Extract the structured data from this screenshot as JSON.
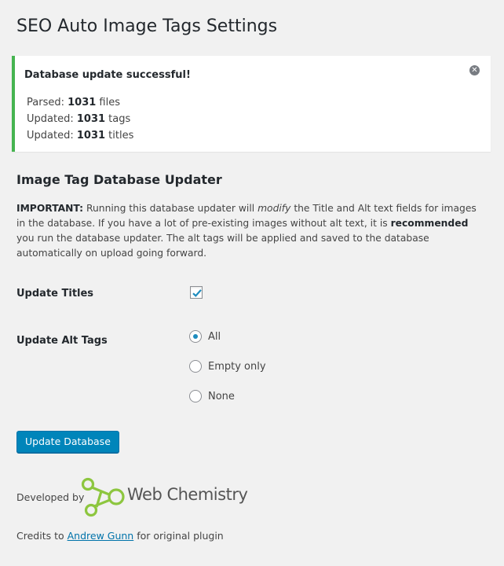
{
  "page": {
    "title": "SEO Auto Image Tags Settings"
  },
  "notice": {
    "title": "Database update successful!",
    "lines": [
      {
        "prefix": "Parsed: ",
        "count": "1031",
        "suffix": " files"
      },
      {
        "prefix": "Updated: ",
        "count": "1031",
        "suffix": " tags"
      },
      {
        "prefix": "Updated: ",
        "count": "1031",
        "suffix": " titles"
      }
    ]
  },
  "section": {
    "heading": "Image Tag Database Updater",
    "desc": {
      "important": "IMPORTANT:",
      "p1": " Running this database updater will ",
      "modify": "modify",
      "p2": " the Title and Alt text fields for images in the database. If you have a lot of pre-existing images without alt text, it is ",
      "recommended": "recommended",
      "p3": " you run the database updater. The alt tags will be applied and saved to the database automatically on upload going forward."
    }
  },
  "form": {
    "update_titles_label": "Update Titles",
    "update_titles_checked": true,
    "update_alt_label": "Update Alt Tags",
    "alt_options": [
      "All",
      "Empty only",
      "None"
    ],
    "alt_selected": "All",
    "submit_label": "Update Database"
  },
  "footer": {
    "developed_by": "Developed by",
    "logo_text": "Web Chemistry",
    "credits_prefix": "Credits to ",
    "credits_link": "Andrew Gunn",
    "credits_suffix": " for original plugin"
  },
  "colors": {
    "success": "#46b450",
    "primary": "#0085ba",
    "link": "#0073aa",
    "logo_green": "#8dc63f"
  }
}
